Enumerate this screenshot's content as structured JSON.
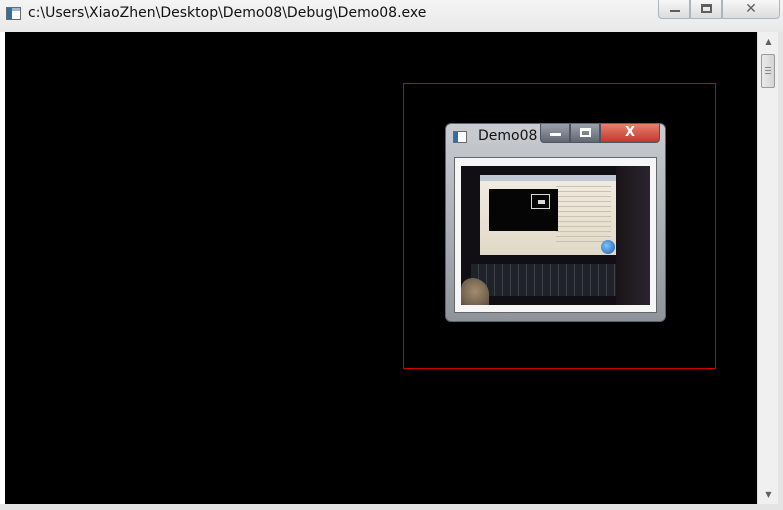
{
  "window": {
    "title": "c:\\Users\\XiaoZhen\\Desktop\\Demo08\\Debug\\Demo08.exe",
    "buttons": {
      "minimize": "–",
      "maximize": "▭",
      "close": "✕"
    }
  },
  "console": {
    "background": "#000000"
  },
  "overlay": {
    "rect_color": "#d40000"
  },
  "inner_window": {
    "title": "Demo08",
    "buttons": {
      "minimize": "–",
      "maximize": "▭",
      "close": "X"
    },
    "content": "camera-frame"
  },
  "scrollbar": {
    "up": "▲",
    "down": "▼"
  },
  "icons": [
    "app-icon",
    "minimize-icon",
    "maximize-icon",
    "close-icon",
    "camera-image"
  ]
}
